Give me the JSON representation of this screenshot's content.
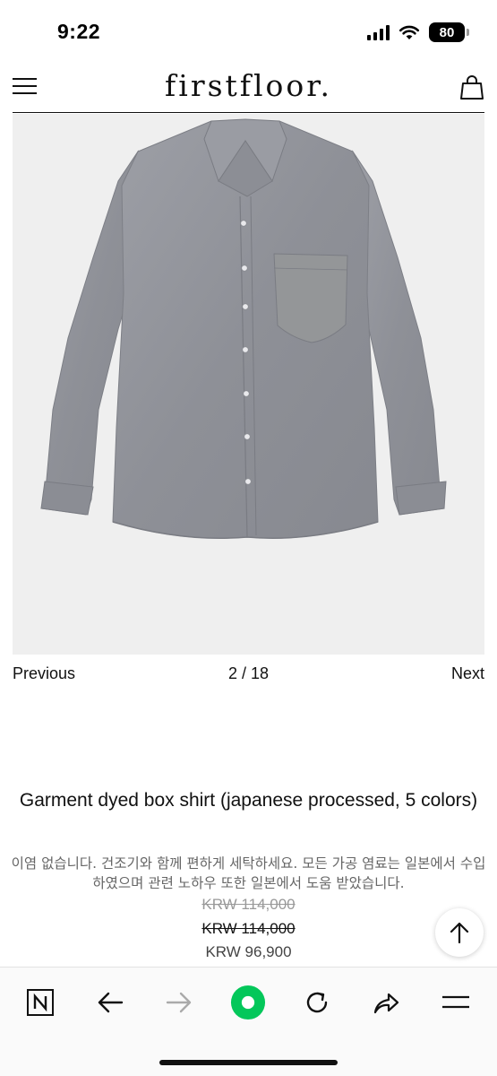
{
  "status_bar": {
    "time": "9:22",
    "battery": "80",
    "icons": [
      "cellular-signal-icon",
      "wifi-icon",
      "battery-icon"
    ]
  },
  "header": {
    "logo": "firstfloor.",
    "icons": [
      "hamburger-menu-icon",
      "shopping-bag-icon"
    ]
  },
  "product_image": {
    "subject": "grey long-sleeve button-up shirt with chest pocket"
  },
  "pager": {
    "previous": "Previous",
    "count": "2 / 18",
    "next": "Next"
  },
  "product": {
    "title": "Garment dyed box shirt (japanese processed, 5 colors)",
    "description": "이염 없습니다. 건조기와 함께 편하게 세탁하세요. 모든 가공 염료는 일본에서 수입 하였으며 관련 노하우 또한 일본에서 도움 받았습니다.",
    "price_original_1": "KRW 114,000",
    "price_original_2": "KRW 114,000",
    "price_sale": "KRW 96,900"
  },
  "browser_bar": {
    "icons": [
      "naver-n-icon",
      "back-arrow-icon",
      "forward-arrow-icon",
      "green-home-icon",
      "reload-icon",
      "share-icon",
      "menu-icon"
    ],
    "accent_color": "#03c75a"
  }
}
